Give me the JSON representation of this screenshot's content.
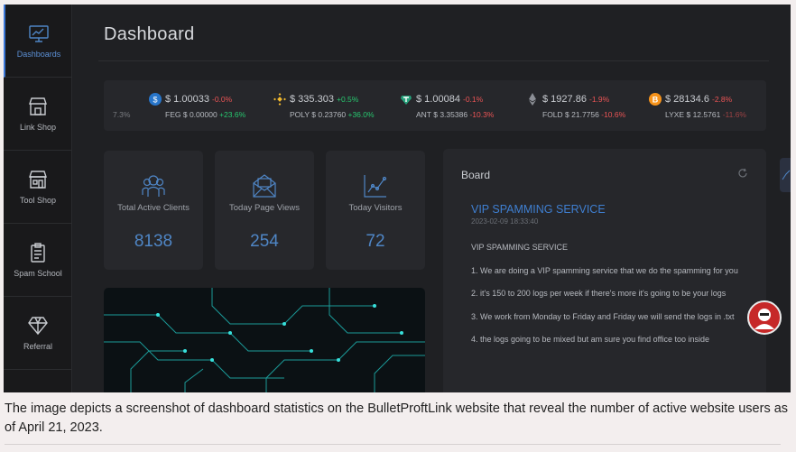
{
  "sidebar": {
    "items": [
      {
        "label": "Dashboards",
        "icon": "dashboard-icon",
        "active": true
      },
      {
        "label": "Link Shop",
        "icon": "shop-icon"
      },
      {
        "label": "Tool Shop",
        "icon": "tool-shop-icon"
      },
      {
        "label": "Spam School",
        "icon": "clipboard-icon"
      },
      {
        "label": "Referral",
        "icon": "diamond-icon"
      }
    ]
  },
  "header": {
    "title": "Dashboard"
  },
  "ticker": [
    {
      "partial": "7.3%"
    },
    {
      "icon": "usd-coin-icon",
      "price": "$ 1.00033",
      "change": "-0.0%",
      "sub_name": "FEG",
      "sub_price": "$ 0.00000",
      "sub_change": "+23.6%"
    },
    {
      "icon": "binance-icon",
      "price": "$ 335.303",
      "change": "+0.5%",
      "sub_name": "POLY",
      "sub_price": "$ 0.23760",
      "sub_change": "+36.0%"
    },
    {
      "icon": "tether-icon",
      "price": "$ 1.00084",
      "change": "-0.1%",
      "sub_name": "ANT",
      "sub_price": "$ 3.35386",
      "sub_change": "-10.3%"
    },
    {
      "icon": "ethereum-icon",
      "price": "$ 1927.86",
      "change": "-1.9%",
      "sub_name": "FOLD",
      "sub_price": "$ 21.7756",
      "sub_change": "-10.6%"
    },
    {
      "icon": "bitcoin-icon",
      "price": "$ 28134.6",
      "change": "-2.8%",
      "sub_name": "LYXE",
      "sub_price": "$ 12.5761",
      "sub_change": "-11.6%"
    }
  ],
  "stats": [
    {
      "label": "Total Active Clients",
      "value": "8138",
      "icon": "users-icon"
    },
    {
      "label": "Today Page Views",
      "value": "254",
      "icon": "envelope-icon"
    },
    {
      "label": "Today Visitors",
      "value": "72",
      "icon": "chart-icon"
    }
  ],
  "board": {
    "title": "Board",
    "post_title": "VIP SPAMMING SERVICE",
    "post_date": "2023-02-09 18:33:40",
    "paragraphs": [
      "VIP SPAMMING SERVICE",
      "1. We are doing a VIP spamming service that we do the spamming for you",
      "2. it's 150 to 200 logs per week if there's more it's going to be your logs",
      "3. We work from Monday to Friday and Friday we will send the logs in .txt",
      "4. the logs going to be mixed but am sure you find office too inside"
    ]
  },
  "caption": "The image depicts a screenshot of dashboard statistics on the BulletProftLink website that reveal the number of active website users as of April 21, 2023.",
  "colors": {
    "accent": "#3c78d8",
    "positive": "#28c76f",
    "negative": "#ea5455",
    "background": "#1f2023"
  }
}
